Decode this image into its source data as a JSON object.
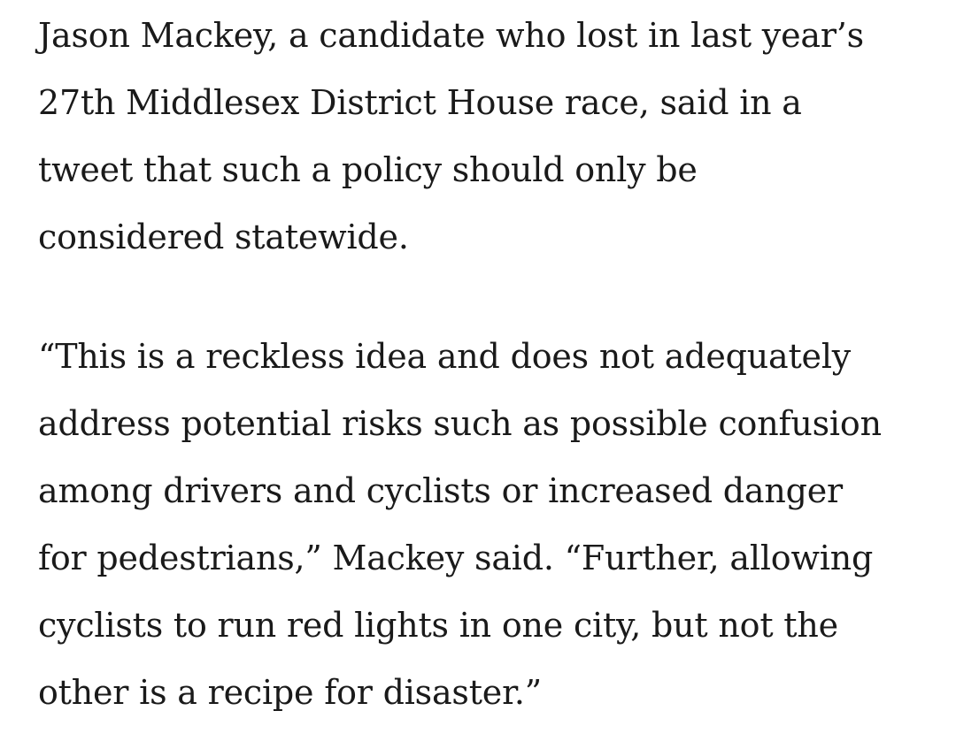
{
  "article": {
    "paragraphs": [
      {
        "lines": [
          "Jason Mackey, a candidate who lost in last year’s",
          "27th Middlesex District House race, said in a",
          "tweet that such a policy should only be",
          "considered statewide."
        ]
      },
      {
        "lines": [
          "“This is a reckless idea and does not adequately",
          "address potential risks such as possible confusion",
          "among drivers and cyclists or increased danger",
          "for pedestrians,” Mackey said. “Further, allowing",
          "cyclists to run red lights in one city, but not the",
          "other is a recipe for disaster.”"
        ]
      }
    ]
  },
  "colors": {
    "text": "#1a1a1a",
    "background": "#ffffff"
  }
}
